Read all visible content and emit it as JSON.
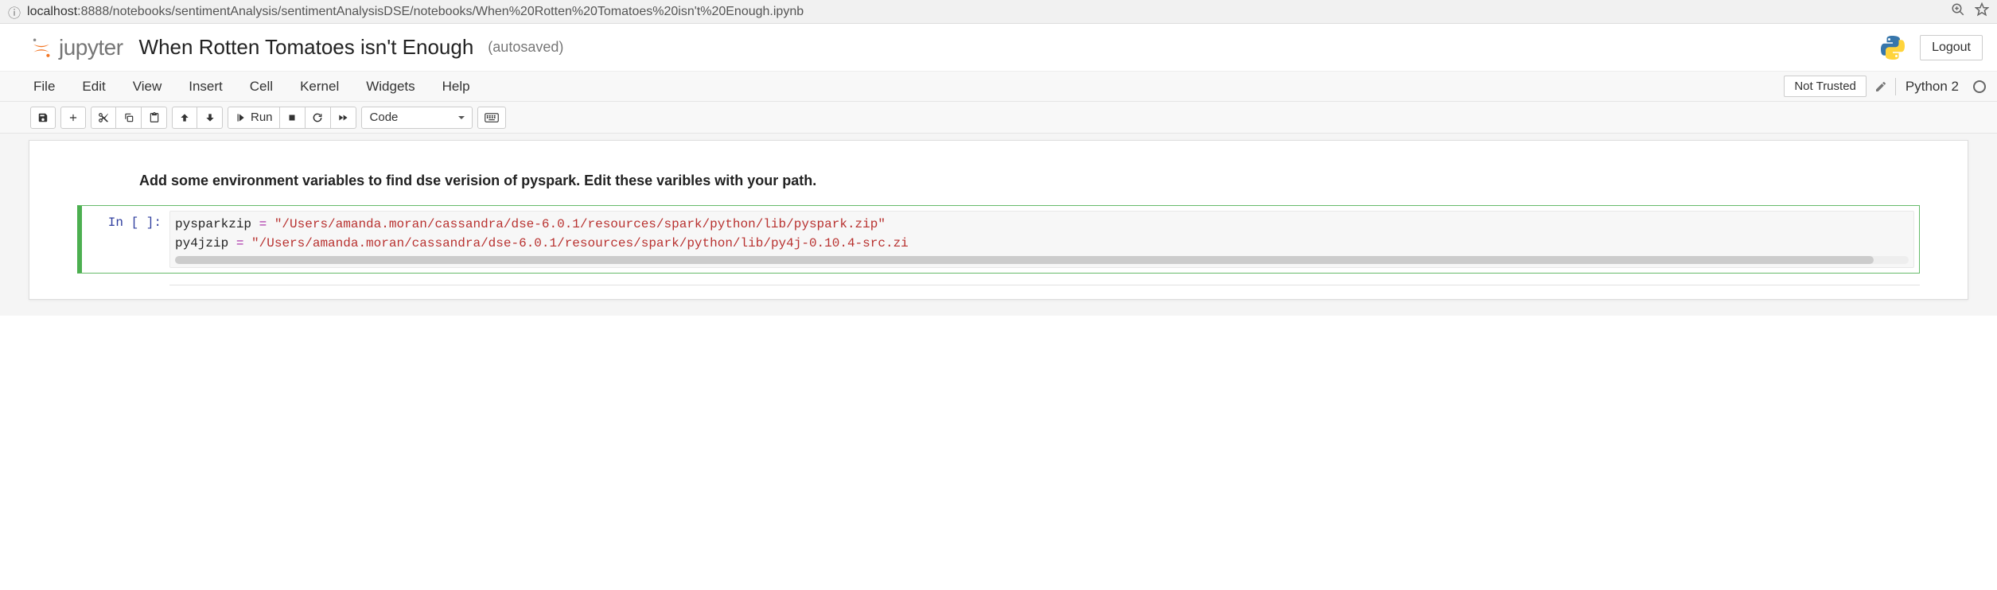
{
  "browser": {
    "url_host": "localhost",
    "url_port": ":8888",
    "url_path": "/notebooks/sentimentAnalysis/sentimentAnalysisDSE/notebooks/When%20Rotten%20Tomatoes%20isn't%20Enough.ipynb"
  },
  "header": {
    "logo_text": "jupyter",
    "title": "When Rotten Tomatoes isn't Enough",
    "autosave": "(autosaved)",
    "logout": "Logout"
  },
  "menubar": {
    "items": [
      "File",
      "Edit",
      "View",
      "Insert",
      "Cell",
      "Kernel",
      "Widgets",
      "Help"
    ],
    "not_trusted": "Not Trusted",
    "kernel_name": "Python 2"
  },
  "toolbar": {
    "run_label": "Run",
    "cell_type": "Code"
  },
  "cells": {
    "heading": "Add some environment variables to find dse verision of pyspark. Edit these varibles with your path.",
    "code": {
      "prompt": "In [ ]:",
      "line1_var": "pysparkzip",
      "line1_eq": " = ",
      "line1_str": "\"/Users/amanda.moran/cassandra/dse-6.0.1/resources/spark/python/lib/pyspark.zip\"",
      "line2_var": "py4jzip",
      "line2_eq": " = ",
      "line2_str": "\"/Users/amanda.moran/cassandra/dse-6.0.1/resources/spark/python/lib/py4j-0.10.4-src.zi"
    }
  }
}
